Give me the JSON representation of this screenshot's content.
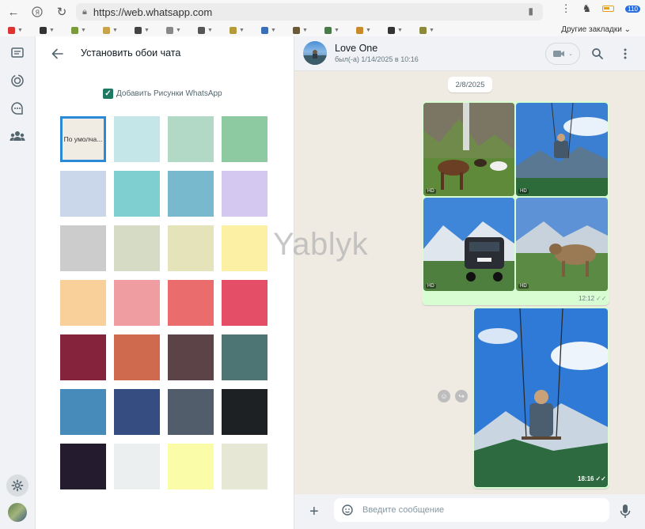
{
  "browser": {
    "url": "https://web.whatsapp.com",
    "bookmarks_other": "Другие закладки",
    "tab_count_badge": "110"
  },
  "wallpaper_panel": {
    "title": "Установить обои чата",
    "checkbox_label": "Добавить Рисунки WhatsApp",
    "default_swatch_label": "По умолча...",
    "swatches": [
      "#f0ebe3",
      "#c4e6e8",
      "#b2d9c6",
      "#8dcaa1",
      "#cad7ea",
      "#7fcfd1",
      "#78b9cd",
      "#d4c7f0",
      "#cccccc",
      "#d5dbc4",
      "#e4e3b9",
      "#fbf0a4",
      "#f9cf9a",
      "#f09da1",
      "#ea6c6c",
      "#e44e66",
      "#86233c",
      "#cf6a4e",
      "#5c4347",
      "#4d7573",
      "#468bb9",
      "#354d80",
      "#515d6a",
      "#1e2124",
      "#241b2e",
      "#ebefef",
      "#fbfca7",
      "#e6e8d5"
    ]
  },
  "chat": {
    "contact_name": "Love One",
    "contact_status": "был(-а) 1/14/2025 в 10:16",
    "date_label": "2/8/2025",
    "album_time": "12:12",
    "single_time": "18:16",
    "hd_label": "HD",
    "input_placeholder": "Введите сообщение"
  },
  "watermark": "Yablyk",
  "colors": {
    "accent": "#1f7a64",
    "bubble_out": "#d9fdd3",
    "chat_bg": "#efeae2",
    "selected_border": "#2a8ad6"
  }
}
